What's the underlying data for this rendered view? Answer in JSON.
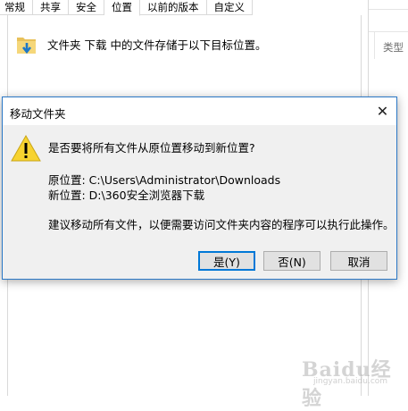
{
  "properties_window": {
    "tabs": [
      {
        "label": "常规",
        "active": false
      },
      {
        "label": "共享",
        "active": false
      },
      {
        "label": "安全",
        "active": false
      },
      {
        "label": "位置",
        "active": true
      },
      {
        "label": "以前的版本",
        "active": false
      },
      {
        "label": "自定义",
        "active": false
      }
    ],
    "location_description": "文件夹 下载 中的文件存储于以下目标位置。"
  },
  "explorer_background": {
    "column_header": "类型"
  },
  "dialog": {
    "title": "移动文件夹",
    "close_glyph": "✕",
    "question": "是否要将所有文件从原位置移动到新位置?",
    "source_line": "原位置: C:\\Users\\Administrator\\Downloads",
    "destination_line": "新位置: D:\\360安全浏览器下载",
    "hint": "建议移动所有文件，以便需要访问文件夹内容的程序可以执行此操作。",
    "buttons": {
      "yes": "是(Y)",
      "no": "否(N)",
      "cancel": "取消"
    },
    "icon": "warning-icon",
    "accent_color": "#0078d7"
  },
  "watermark": {
    "logo_text": "Baidu经验",
    "sub_text": "jingyan.baidu.com"
  }
}
